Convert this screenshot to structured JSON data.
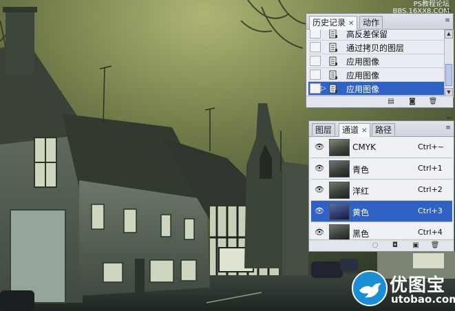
{
  "watermark": {
    "line1": "PS教程论坛",
    "line2": "BBS.16XX8.COM",
    "brand_cn": "优图宝",
    "brand_url": "utobao.com"
  },
  "history_panel": {
    "tabs": [
      {
        "label": "历史记录",
        "active": true,
        "closable": true
      },
      {
        "label": "动作",
        "active": false,
        "closable": false
      }
    ],
    "items": [
      {
        "label": "高反差保留",
        "selected": false
      },
      {
        "label": "通过拷贝的图层",
        "selected": false
      },
      {
        "label": "应用图像",
        "selected": false
      },
      {
        "label": "应用图像",
        "selected": false
      },
      {
        "label": "应用图像",
        "selected": true
      }
    ],
    "footer_icons": [
      "new-document-icon",
      "snapshot-camera-icon",
      "trash-icon"
    ]
  },
  "channels_panel": {
    "tabs": [
      {
        "label": "图层",
        "active": false,
        "closable": false
      },
      {
        "label": "通道",
        "active": true,
        "closable": true
      },
      {
        "label": "路径",
        "active": false,
        "closable": false
      }
    ],
    "channels": [
      {
        "name": "CMYK",
        "shortcut": "Ctrl+~",
        "selected": false,
        "visible": true
      },
      {
        "name": "青色",
        "shortcut": "Ctrl+1",
        "selected": false,
        "visible": true
      },
      {
        "name": "洋红",
        "shortcut": "Ctrl+2",
        "selected": false,
        "visible": true
      },
      {
        "name": "黄色",
        "shortcut": "Ctrl+3",
        "selected": true,
        "visible": true
      },
      {
        "name": "黑色",
        "shortcut": "Ctrl+4",
        "selected": false,
        "visible": true
      }
    ],
    "footer_icons": [
      "load-selection-icon",
      "save-selection-icon",
      "new-channel-icon",
      "trash-icon"
    ]
  },
  "colors": {
    "selection": "#2f62c4",
    "panel_bg": "#e9ecf2",
    "sky": "#8f9a5a"
  }
}
